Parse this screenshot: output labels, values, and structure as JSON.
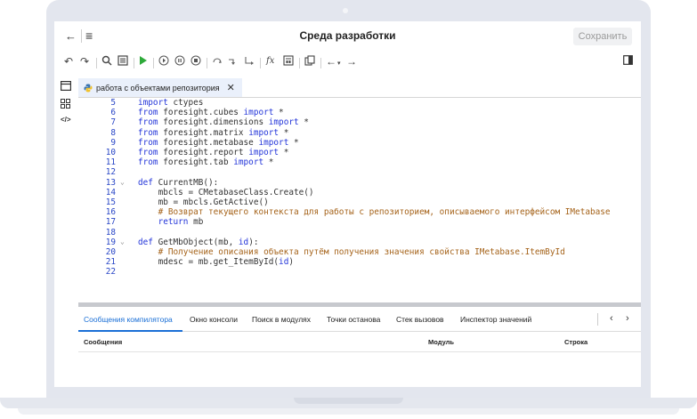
{
  "window": {
    "title": "Среда разработки",
    "save_label": "Сохранить"
  },
  "toolbar": {
    "icons": [
      "undo-icon",
      "redo-icon",
      "search-icon",
      "panel-icon",
      "run-icon",
      "step-icon",
      "pause-icon",
      "stop-icon",
      "step-into-icon",
      "step-over-icon",
      "step-out-icon",
      "function-icon",
      "calc-icon",
      "copy-icon",
      "back-arrow-icon",
      "forward-arrow-icon",
      "sidebar-toggle-icon"
    ],
    "fx_label": "fx"
  },
  "sidebar": {
    "icons": [
      "module-icon",
      "grid-icon",
      "code-icon"
    ]
  },
  "file_tab": {
    "label": "работа с объектами репозитория",
    "close": "✕"
  },
  "editor": {
    "lines": [
      {
        "n": "5",
        "fold": "",
        "segments": [
          {
            "t": "import",
            "c": "kw"
          },
          {
            "t": " ctypes",
            "c": "tx"
          }
        ]
      },
      {
        "n": "6",
        "fold": "",
        "segments": [
          {
            "t": "from",
            "c": "kw"
          },
          {
            "t": " foresight.cubes ",
            "c": "tx"
          },
          {
            "t": "import",
            "c": "kw"
          },
          {
            "t": " *",
            "c": "tx"
          }
        ]
      },
      {
        "n": "7",
        "fold": "",
        "segments": [
          {
            "t": "from",
            "c": "kw"
          },
          {
            "t": " foresight.dimensions ",
            "c": "tx"
          },
          {
            "t": "import",
            "c": "kw"
          },
          {
            "t": " *",
            "c": "tx"
          }
        ]
      },
      {
        "n": "8",
        "fold": "",
        "segments": [
          {
            "t": "from",
            "c": "kw"
          },
          {
            "t": " foresight.matrix ",
            "c": "tx"
          },
          {
            "t": "import",
            "c": "kw"
          },
          {
            "t": " *",
            "c": "tx"
          }
        ]
      },
      {
        "n": "9",
        "fold": "",
        "segments": [
          {
            "t": "from",
            "c": "kw"
          },
          {
            "t": " foresight.metabase ",
            "c": "tx"
          },
          {
            "t": "import",
            "c": "kw"
          },
          {
            "t": " *",
            "c": "tx"
          }
        ]
      },
      {
        "n": "10",
        "fold": "",
        "segments": [
          {
            "t": "from",
            "c": "kw"
          },
          {
            "t": " foresight.report ",
            "c": "tx"
          },
          {
            "t": "import",
            "c": "kw"
          },
          {
            "t": " *",
            "c": "tx"
          }
        ]
      },
      {
        "n": "11",
        "fold": "",
        "segments": [
          {
            "t": "from",
            "c": "kw"
          },
          {
            "t": " foresight.tab ",
            "c": "tx"
          },
          {
            "t": "import",
            "c": "kw"
          },
          {
            "t": " *",
            "c": "tx"
          }
        ]
      },
      {
        "n": "12",
        "fold": "",
        "segments": []
      },
      {
        "n": "13",
        "fold": "⌄",
        "segments": [
          {
            "t": "def",
            "c": "kw"
          },
          {
            "t": " CurrentMB():",
            "c": "tx"
          }
        ]
      },
      {
        "n": "14",
        "fold": "",
        "segments": [
          {
            "t": "    mbcls = CMetabaseClass.Create()",
            "c": "tx"
          }
        ]
      },
      {
        "n": "15",
        "fold": "",
        "segments": [
          {
            "t": "    mb = mbcls.GetActive()",
            "c": "tx"
          }
        ]
      },
      {
        "n": "16",
        "fold": "",
        "segments": [
          {
            "t": "    # Возврат текущего контекста для работы с репозиторием, описываемого интерфейсом IMetabase",
            "c": "cm"
          }
        ]
      },
      {
        "n": "17",
        "fold": "",
        "segments": [
          {
            "t": "    ",
            "c": "tx"
          },
          {
            "t": "return",
            "c": "kw"
          },
          {
            "t": " mb",
            "c": "tx"
          }
        ]
      },
      {
        "n": "18",
        "fold": "",
        "segments": []
      },
      {
        "n": "19",
        "fold": "⌄",
        "segments": [
          {
            "t": "def",
            "c": "kw"
          },
          {
            "t": " GetMbObject(mb, ",
            "c": "tx"
          },
          {
            "t": "id",
            "c": "kw"
          },
          {
            "t": "):",
            "c": "tx"
          }
        ]
      },
      {
        "n": "20",
        "fold": "",
        "segments": [
          {
            "t": "    # Получение описания объекта путём получения значения свойства IMetabase.ItemById",
            "c": "cm"
          }
        ]
      },
      {
        "n": "21",
        "fold": "",
        "segments": [
          {
            "t": "    mdesc = mb.get_ItemById(",
            "c": "tx"
          },
          {
            "t": "id",
            "c": "kw"
          },
          {
            "t": ")",
            "c": "tx"
          }
        ]
      },
      {
        "n": "22",
        "fold": "",
        "segments": []
      }
    ]
  },
  "bottom_panel": {
    "tabs": [
      "Сообщения компилятора",
      "Окно консоли",
      "Поиск в модулях",
      "Точки останова",
      "Стек вызовов",
      "Инспектор значений"
    ],
    "nav_prev": "‹",
    "nav_next": "›",
    "columns": [
      "Сообщения",
      "Модуль",
      "Строка"
    ]
  }
}
